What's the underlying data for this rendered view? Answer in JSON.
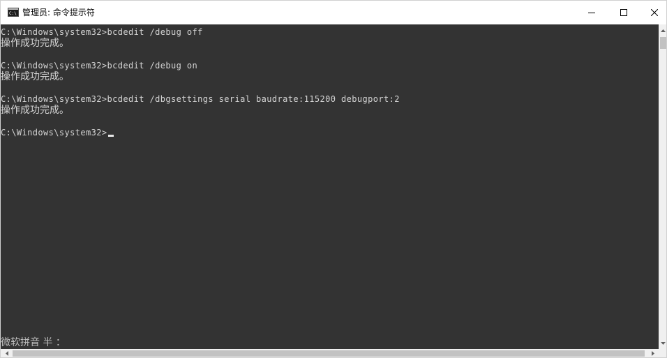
{
  "window": {
    "title": "管理员: 命令提示符",
    "icon": "cmd-icon",
    "buttons": {
      "minimize": "minimize-icon",
      "maximize": "maximize-icon",
      "close": "close-icon"
    }
  },
  "console": {
    "background": "#333333",
    "foreground": "#d4d4d4",
    "lines": [
      {
        "type": "cmd",
        "text": "C:\\Windows\\system32>bcdedit /debug off"
      },
      {
        "type": "out",
        "text": "操作成功完成。"
      },
      {
        "type": "blank",
        "text": ""
      },
      {
        "type": "cmd",
        "text": "C:\\Windows\\system32>bcdedit /debug on"
      },
      {
        "type": "out",
        "text": "操作成功完成。"
      },
      {
        "type": "blank",
        "text": ""
      },
      {
        "type": "cmd",
        "text": "C:\\Windows\\system32>bcdedit /dbgsettings serial baudrate:115200 debugport:2"
      },
      {
        "type": "out",
        "text": "操作成功完成。"
      },
      {
        "type": "blank",
        "text": ""
      },
      {
        "type": "prompt",
        "text": "C:\\Windows\\system32>"
      }
    ],
    "ime_status": "微软拼音 半 ："
  }
}
